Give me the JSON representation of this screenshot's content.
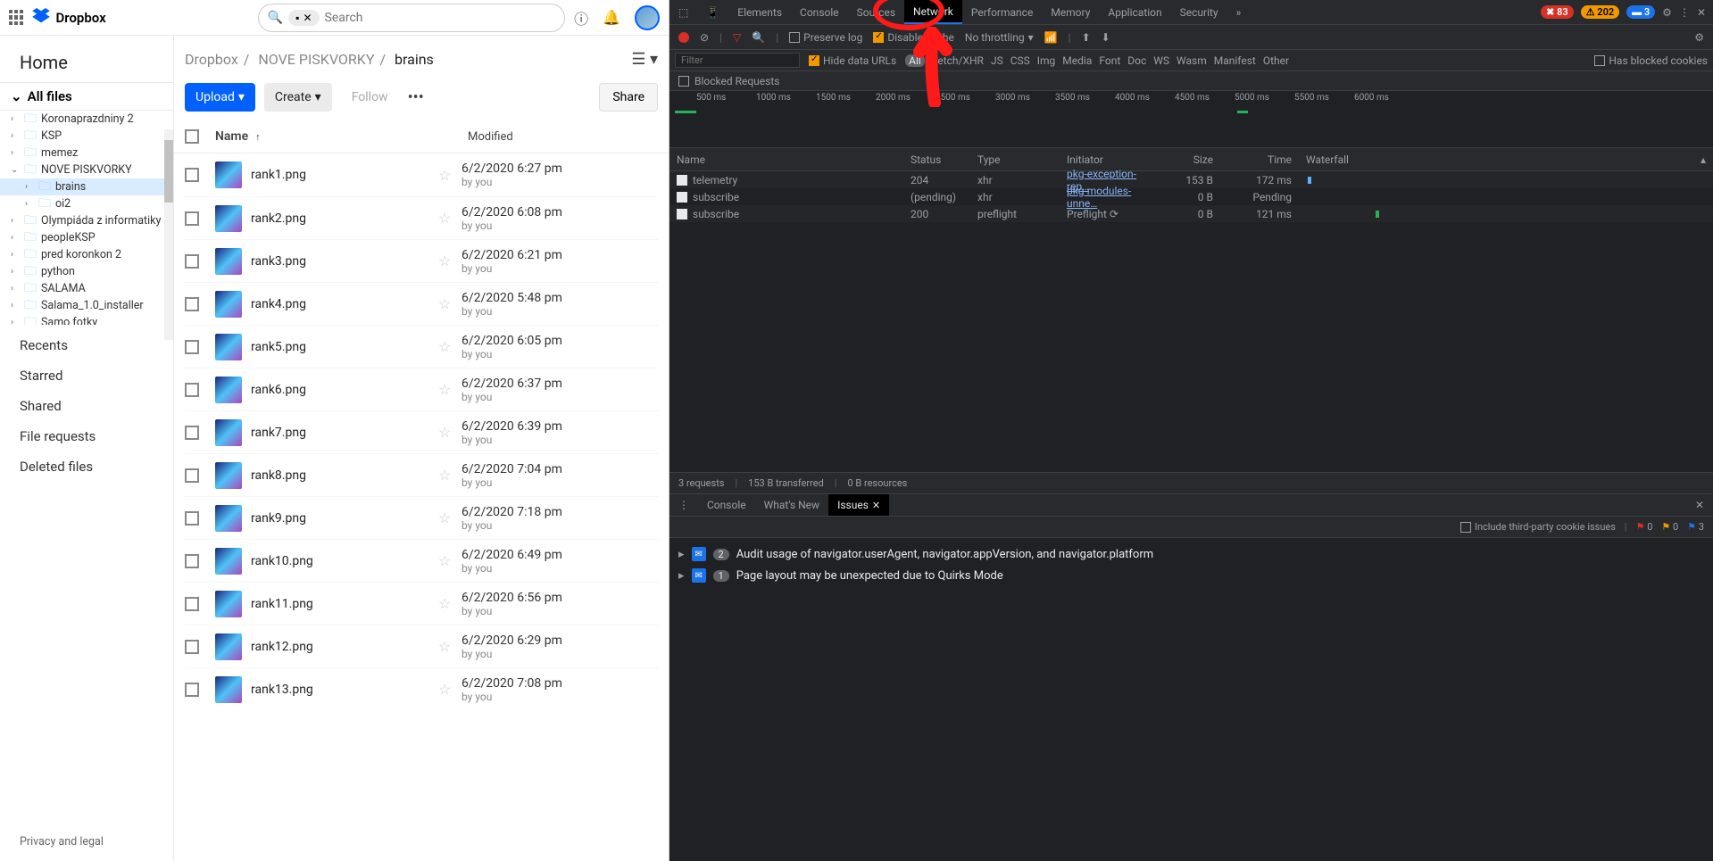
{
  "dropbox": {
    "product": "Dropbox",
    "search_placeholder": "Search",
    "folder_pill": "■",
    "sidebar": {
      "home": "Home",
      "all_files": "All files",
      "tree": [
        {
          "label": "Koronaprazdniny 2",
          "level": 1,
          "cut": true
        },
        {
          "label": "KSP",
          "level": 1
        },
        {
          "label": "memez",
          "level": 1
        },
        {
          "label": "NOVE PISKVORKY",
          "level": 1,
          "expanded": true
        },
        {
          "label": "brains",
          "level": 2,
          "selected": true
        },
        {
          "label": "oi2",
          "level": 2
        },
        {
          "label": "Olympiáda z informatiky",
          "level": 1
        },
        {
          "label": "peopleKSP",
          "level": 1
        },
        {
          "label": "pred koronkon 2",
          "level": 1
        },
        {
          "label": "python",
          "level": 1
        },
        {
          "label": "SALAMA",
          "level": 1
        },
        {
          "label": "Salama_1.0_installer",
          "level": 1
        },
        {
          "label": "Samo fotky",
          "level": 1
        }
      ],
      "links": [
        "Recents",
        "Starred",
        "Shared",
        "File requests",
        "Deleted files"
      ],
      "footer": "Privacy and legal"
    },
    "breadcrumbs": [
      "Dropbox",
      "NOVE PISKVORKY",
      "brains"
    ],
    "actions": {
      "upload": "Upload",
      "create": "Create",
      "follow": "Follow",
      "share": "Share"
    },
    "columns": {
      "name": "Name",
      "modified": "Modified"
    },
    "by_you": "by you",
    "files": [
      {
        "name": "rank1.png",
        "modified": "6/2/2020 6:27 pm"
      },
      {
        "name": "rank2.png",
        "modified": "6/2/2020 6:08 pm"
      },
      {
        "name": "rank3.png",
        "modified": "6/2/2020 6:21 pm"
      },
      {
        "name": "rank4.png",
        "modified": "6/2/2020 5:48 pm"
      },
      {
        "name": "rank5.png",
        "modified": "6/2/2020 6:05 pm"
      },
      {
        "name": "rank6.png",
        "modified": "6/2/2020 6:37 pm"
      },
      {
        "name": "rank7.png",
        "modified": "6/2/2020 6:39 pm"
      },
      {
        "name": "rank8.png",
        "modified": "6/2/2020 7:04 pm"
      },
      {
        "name": "rank9.png",
        "modified": "6/2/2020 7:18 pm"
      },
      {
        "name": "rank10.png",
        "modified": "6/2/2020 6:49 pm"
      },
      {
        "name": "rank11.png",
        "modified": "6/2/2020 6:56 pm"
      },
      {
        "name": "rank12.png",
        "modified": "6/2/2020 6:29 pm"
      },
      {
        "name": "rank13.png",
        "modified": "6/2/2020 7:08 pm"
      }
    ]
  },
  "devtools": {
    "tabs": [
      "Elements",
      "Console",
      "Sources",
      "Network",
      "Performance",
      "Memory",
      "Application",
      "Security"
    ],
    "active_tab": "Network",
    "badges": {
      "errors": "83",
      "warnings": "202",
      "info": "3"
    },
    "toolbar": {
      "preserve": "Preserve log",
      "disable": "Disable cache",
      "throttling": "No throttling"
    },
    "filter": {
      "placeholder": "Filter",
      "hide_urls": "Hide data URLs",
      "types": [
        "All",
        "Fetch/XHR",
        "JS",
        "CSS",
        "Img",
        "Media",
        "Font",
        "Doc",
        "WS",
        "Wasm",
        "Manifest",
        "Other"
      ],
      "blocked_cookies": "Has blocked cookies",
      "blocked_requests": "Blocked Requests"
    },
    "timeline_labels": [
      "500 ms",
      "1000 ms",
      "1500 ms",
      "2000 ms",
      "2500 ms",
      "3000 ms",
      "3500 ms",
      "4000 ms",
      "4500 ms",
      "5000 ms",
      "5500 ms",
      "6000 ms"
    ],
    "net_cols": {
      "name": "Name",
      "status": "Status",
      "type": "Type",
      "initiator": "Initiator",
      "size": "Size",
      "time": "Time",
      "waterfall": "Waterfall"
    },
    "requests": [
      {
        "name": "telemetry",
        "status": "204",
        "type": "xhr",
        "initiator": "pkg-exception-rep…",
        "size": "153 B",
        "time": "172 ms"
      },
      {
        "name": "subscribe",
        "status": "(pending)",
        "type": "xhr",
        "initiator": "pkg-modules-unne…",
        "size": "0 B",
        "time": "Pending"
      },
      {
        "name": "subscribe",
        "status": "200",
        "type": "preflight",
        "initiator": "Preflight ⟳",
        "size": "0 B",
        "time": "121 ms"
      }
    ],
    "statusbar": {
      "requests": "3 requests",
      "transferred": "153 B transferred",
      "resources": "0 B resources"
    },
    "drawer": {
      "tabs": [
        "Console",
        "What's New",
        "Issues"
      ],
      "active": "Issues",
      "include_cookie": "Include third-party cookie issues",
      "flag_counts": {
        "red": "0",
        "yellow": "0",
        "blue": "3"
      },
      "issues": [
        {
          "count": "2",
          "text": "Audit usage of navigator.userAgent, navigator.appVersion, and navigator.platform"
        },
        {
          "count": "1",
          "text": "Page layout may be unexpected due to Quirks Mode"
        }
      ]
    }
  }
}
